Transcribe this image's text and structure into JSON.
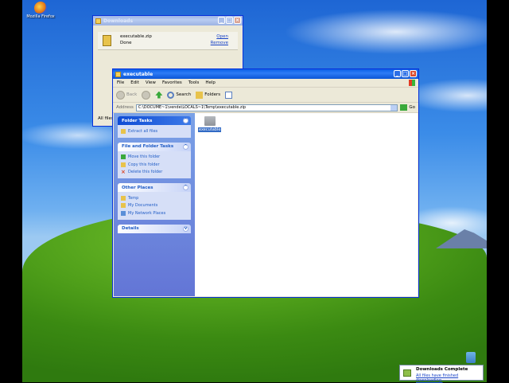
{
  "desktop": {
    "icon_label": "Mozilla Firefox"
  },
  "downloads_window": {
    "title": "Downloads",
    "item": {
      "name": "executable.zip",
      "status": "Done",
      "open_label": "Open",
      "remove_label": "Remove"
    },
    "footer_label": "All files"
  },
  "explorer": {
    "title": "executable",
    "menu": [
      "File",
      "Edit",
      "View",
      "Favorites",
      "Tools",
      "Help"
    ],
    "toolbar": {
      "back_label": "Back",
      "search_label": "Search",
      "folders_label": "Folders"
    },
    "address": {
      "label": "Address",
      "value": "C:\\DOCUME~1\\vende\\LOCALS~1\\Temp\\executable.zip",
      "go_label": "Go"
    },
    "panels": {
      "folder_tasks": {
        "title": "Folder Tasks",
        "items": [
          "Extract all files"
        ]
      },
      "file_folder_tasks": {
        "title": "File and Folder Tasks",
        "items": [
          "Move this folder",
          "Copy this folder",
          "Delete this folder"
        ]
      },
      "other_places": {
        "title": "Other Places",
        "items": [
          "Temp",
          "My Documents",
          "My Network Places"
        ]
      },
      "details": {
        "title": "Details"
      }
    },
    "content": {
      "folder_label": "executable"
    }
  },
  "notification": {
    "title": "Downloads Complete",
    "message": "All files have finished downloading."
  },
  "colors": {
    "xp_blue": "#0a5fe8",
    "link_blue": "#215dc6",
    "selection": "#316ac5"
  }
}
